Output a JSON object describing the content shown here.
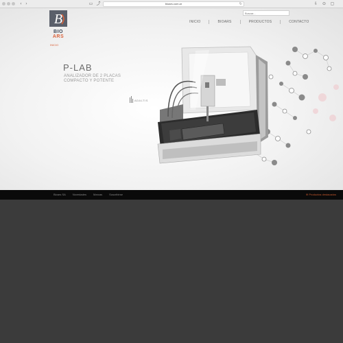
{
  "browser": {
    "url": "bioars.com.ar",
    "back_icon": "chevron-left-icon",
    "forward_icon": "chevron-right-icon"
  },
  "header": {
    "logo_text": "BIO ARS",
    "search_placeholder": "Buscar...",
    "nav": [
      {
        "label": "INICIO"
      },
      {
        "label": "BIOARS"
      },
      {
        "label": "PRODUCTOS"
      },
      {
        "label": "CONTACTO"
      }
    ]
  },
  "breadcrumb": "INICIO",
  "hero": {
    "title": "P-LAB",
    "subtitle_line1": "ANALIZADOR DE 2 PLACAS",
    "subtitle_line2": "COMPACTO Y POTENTE",
    "brand": "ADALTIS"
  },
  "footer": {
    "links": [
      {
        "label": "Bioars SA"
      },
      {
        "label": "Novedades"
      },
      {
        "label": "Marcas"
      },
      {
        "label": "Suscribirse"
      }
    ],
    "featured": "Productos destacados"
  },
  "colors": {
    "accent": "#d9623b",
    "footer_bg": "#0a0a0a",
    "page_bg": "#3b3b3b"
  }
}
